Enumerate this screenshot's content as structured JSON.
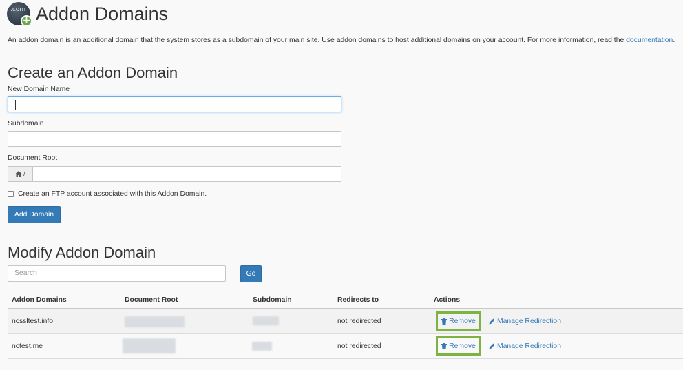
{
  "header": {
    "title": "Addon Domains",
    "logo_text": ".com"
  },
  "intro": {
    "text": "An addon domain is an additional domain that the system stores as a subdomain of your main site. Use addon domains to host additional domains on your account. For more information, read the ",
    "link_label": "documentation",
    "trailing": "."
  },
  "create": {
    "title": "Create an Addon Domain",
    "new_domain_label": "New Domain Name",
    "new_domain_value": "",
    "subdomain_label": "Subdomain",
    "subdomain_value": "",
    "docroot_label": "Document Root",
    "docroot_prefix": "/",
    "docroot_value": "",
    "ftp_label": "Create an FTP account associated with this Addon Domain.",
    "add_button": "Add Domain"
  },
  "modify": {
    "title": "Modify Addon Domain",
    "search_placeholder": "Search",
    "go_button": "Go",
    "columns": [
      "Addon Domains",
      "Document Root",
      "Subdomain",
      "Redirects to",
      "Actions"
    ],
    "rows": [
      {
        "domain": "ncssltest.info",
        "redirect": "not redirected",
        "remove": "Remove",
        "manage": "Manage Redirection"
      },
      {
        "domain": "nctest.me",
        "redirect": "not redirected",
        "remove": "Remove",
        "manage": "Manage Redirection"
      }
    ]
  },
  "icons": {
    "home": "home-icon",
    "trash": "trash-icon",
    "pencil": "pencil-icon"
  },
  "colors": {
    "primary": "#337ab7",
    "highlight": "#7cb342"
  }
}
